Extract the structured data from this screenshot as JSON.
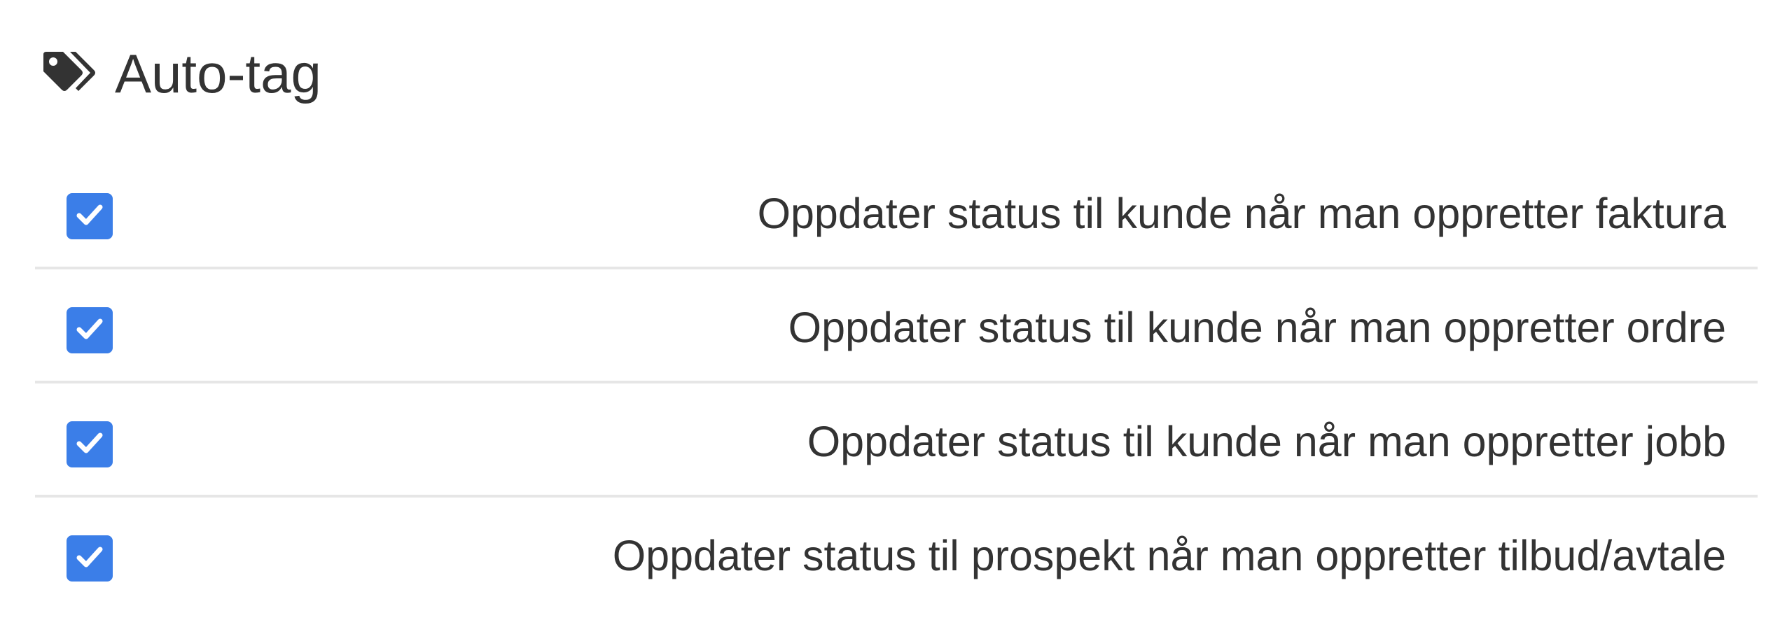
{
  "header": {
    "icon": "tags-icon",
    "title": "Auto-tag"
  },
  "colors": {
    "checkbox_bg": "#3b7ee8",
    "text": "#333333",
    "divider": "#e6e6e6"
  },
  "settings": [
    {
      "label": "Oppdater status til kunde når man oppretter faktura",
      "checked": true
    },
    {
      "label": "Oppdater status til kunde når man oppretter ordre",
      "checked": true
    },
    {
      "label": "Oppdater status til kunde når man oppretter jobb",
      "checked": true
    },
    {
      "label": "Oppdater status til prospekt når man oppretter tilbud/avtale",
      "checked": true
    }
  ]
}
